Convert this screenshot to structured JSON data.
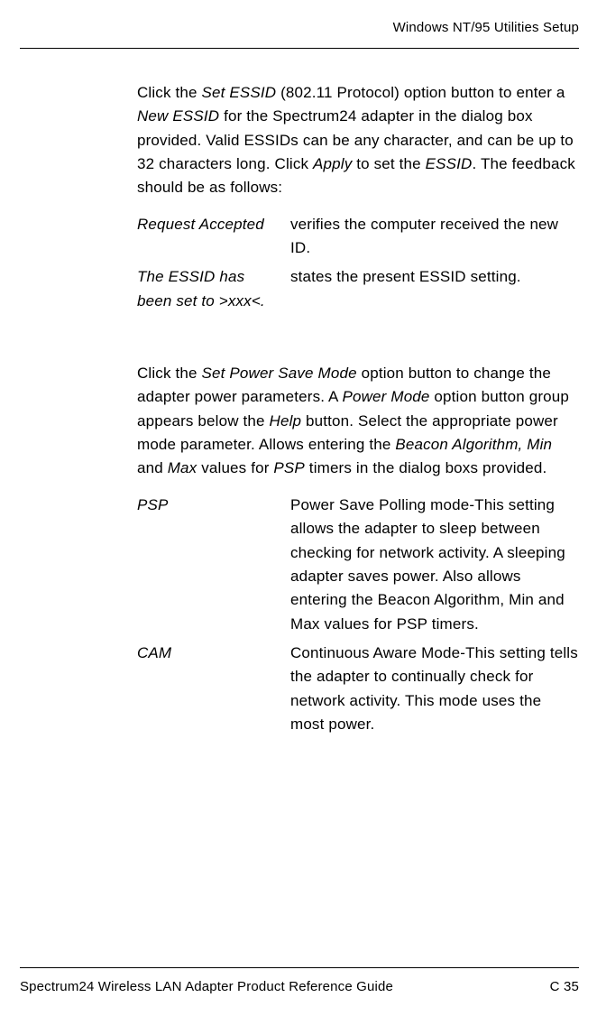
{
  "header": "Windows NT/95 Utilities Setup",
  "para1_pre": "Click the ",
  "para1_i1": "Set ESSID",
  "para1_mid1": " (802.11 Protocol) option button to enter a ",
  "para1_i2": "New ESSID",
  "para1_mid2": " for the Spectrum24 adapter in the dialog box provided. Valid ESSIDs can be any character, and can be up to 32 characters long. Click ",
  "para1_i3": "Apply",
  "para1_mid3": " to set the ",
  "para1_i4": "ESSID",
  "para1_post": ". The feedback should be as follows:",
  "def1": {
    "term": "Request Accepted",
    "desc": "verifies the computer received the new ID."
  },
  "def2": {
    "term": "The ESSID has been set to >xxx<.",
    "desc": "states the present ESSID setting."
  },
  "para2_pre": "Click the ",
  "para2_i1": "Set Power Save Mode",
  "para2_mid1": " option button to change the adapter power parameters. A ",
  "para2_i2": "Power Mode",
  "para2_mid2": " option button group appears below the ",
  "para2_i3": "Help",
  "para2_mid3": " button. Select the appropriate power mode parameter. Allows entering the ",
  "para2_i4": "Beacon Algorithm, Min",
  "para2_mid4": " and ",
  "para2_i5": "Max",
  "para2_mid5": " values for ",
  "para2_i6": "PSP",
  "para2_post": " timers in the dialog boxs provided.",
  "def3": {
    "term": "PSP",
    "desc": "Power Save Polling mode-This setting allows the adapter to sleep between checking for network activity. A sleeping adapter saves power. Also allows entering the Beacon Algorithm, Min and Max values for PSP timers."
  },
  "def4": {
    "term": "CAM",
    "desc": "Continuous Aware Mode-This setting tells the adapter to continually check for network activity. This mode uses the most power."
  },
  "footer_left": "Spectrum24 Wireless LAN Adapter Product Reference Guide",
  "footer_right": "C 35"
}
